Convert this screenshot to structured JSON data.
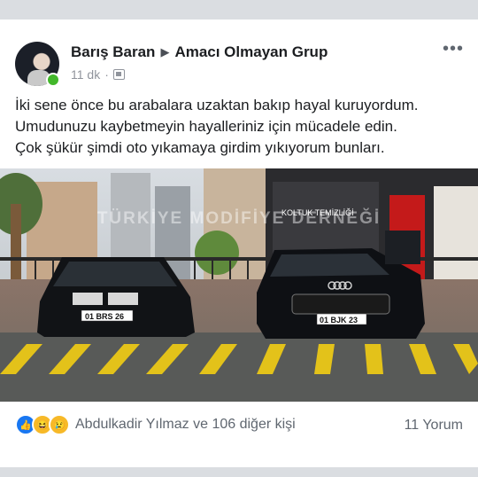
{
  "post": {
    "author": "Barış Baran",
    "group": "Amacı Olmayan Grup",
    "time": "11 dk",
    "separator": "·",
    "more_icon": "more-dots-icon",
    "text_lines": [
      "İki sene önce bu arabalara uzaktan bakıp hayal kuruyordum.",
      "Umudunuzu kaybetmeyin hayalleriniz için mücadele edin.",
      "Çok şükür şimdi oto yıkamaya girdim yıkıyorum bunları."
    ]
  },
  "photo": {
    "watermark": "TÜRKİYE MODİFİYE DERNEĞİ",
    "shop_sign": "KOLTUK TEMİZLİĞİ",
    "plate_left": "01 BRS 26",
    "plate_right": "01 BJK 23"
  },
  "footer": {
    "reaction_icons": [
      "like-icon",
      "haha-icon",
      "sad-icon"
    ],
    "reactors": "Abdulkadir Yılmaz ve 106 diğer kişi",
    "comments": "11 Yorum"
  }
}
